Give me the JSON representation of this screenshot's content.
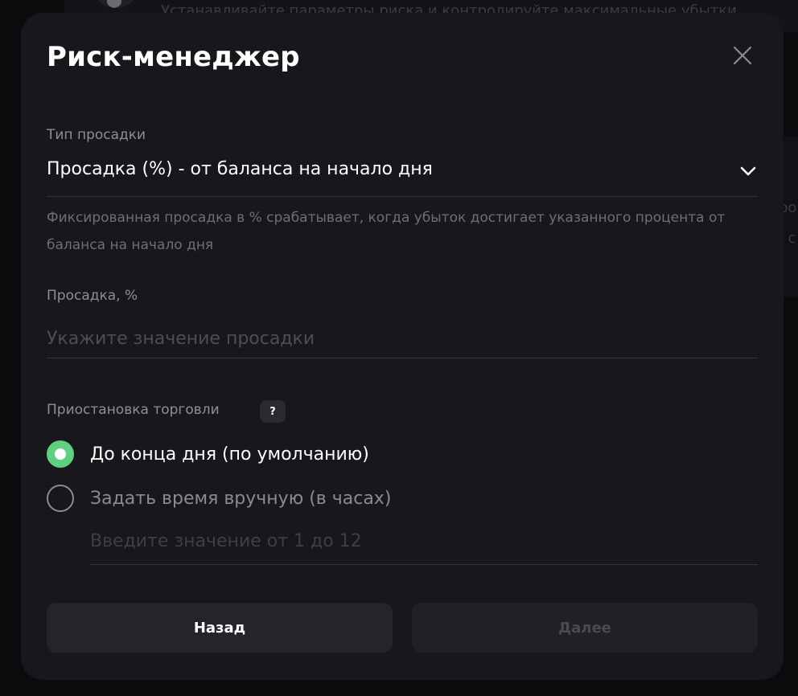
{
  "background": {
    "text": "Устанавливайте параметры риска и контролируйте максимальные убытки.",
    "right_fragment_1": "ро",
    "right_fragment_2": ", с"
  },
  "modal": {
    "title": "Риск-менеджер",
    "drawdown_type": {
      "label": "Тип просадки",
      "selected_value": "Просадка (%) - от баланса на начало дня",
      "helper_text": "Фиксированная просадка в % срабатывает, когда убыток достигает указанного процента от баланса на начало дня"
    },
    "drawdown_percent": {
      "label": "Просадка, %",
      "value": "",
      "placeholder": "Укажите значение просадки"
    },
    "trading_pause": {
      "label": "Приостановка торговли",
      "help_badge": "?",
      "options": [
        {
          "label": "До конца дня (по умолчанию)",
          "selected": true
        },
        {
          "label": "Задать время вручную (в часах)",
          "selected": false
        }
      ],
      "hours_input": {
        "value": "",
        "placeholder": "Введите значение от 1 до 12"
      }
    },
    "buttons": {
      "back": "Назад",
      "next": "Далее"
    }
  },
  "colors": {
    "accent": "#5fcf80",
    "modal_bg": "#17171c",
    "page_bg": "#0b0b0d"
  }
}
